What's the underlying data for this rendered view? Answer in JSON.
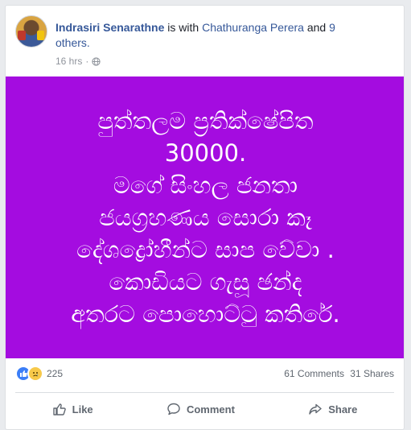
{
  "post": {
    "author": "Indrasiri Senarathne",
    "with_text": " is with ",
    "tagged": "Chathuranga Perera",
    "and_text": " and ",
    "others": "9 others.",
    "time": "16 hrs",
    "time_sep": "·",
    "privacy_icon": "globe-icon"
  },
  "image_text": {
    "lines": [
      "පුත්තලම ප්‍රතික්ෂේපිත",
      "30000.",
      "මගේ සිංහල ජනතා",
      "ජයග්‍රහණය සොරා කෑ",
      "දේශද්‍රෝහීන්ට සාප වේවා .",
      "කොඩියට ගැසූ ඡන්ද",
      "අතරට පොහොට්ටු කතිරේ."
    ],
    "background": "#a40ce0"
  },
  "stats": {
    "reaction_count": "225",
    "comments": "61 Comments",
    "shares": "31 Shares",
    "reaction_icons": [
      "like-icon",
      "sad-icon"
    ]
  },
  "actions": {
    "like": "Like",
    "comment": "Comment",
    "share": "Share"
  }
}
